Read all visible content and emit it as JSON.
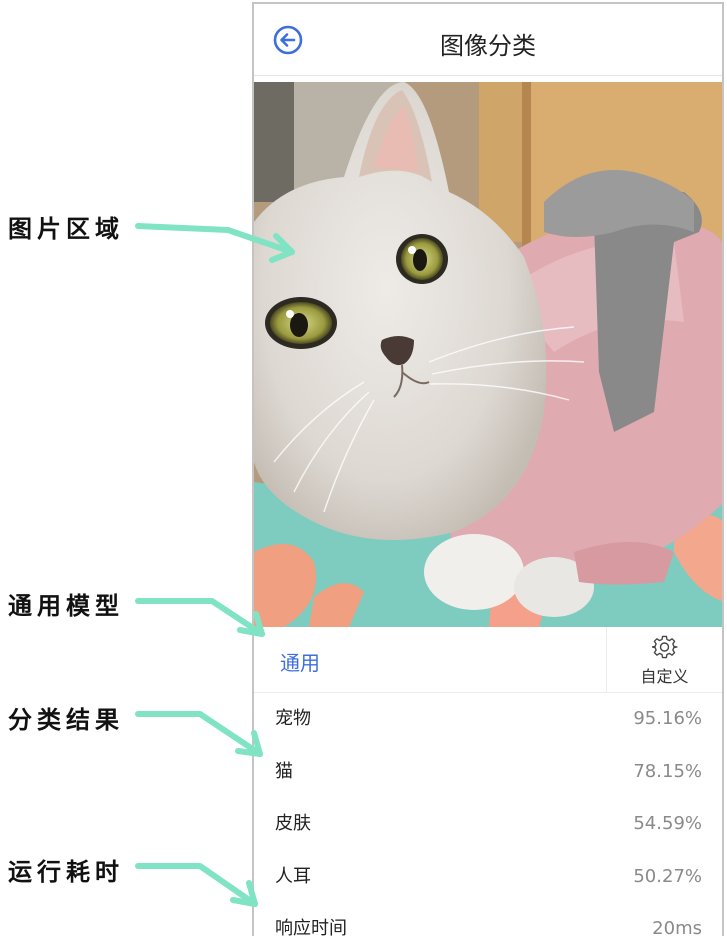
{
  "annotations": {
    "image_area": "图片区域",
    "general_model": "通用模型",
    "classification_results": "分类结果",
    "run_time": "运行耗时"
  },
  "header": {
    "title": "图像分类",
    "back_icon": "back-arrow-icon"
  },
  "model_bar": {
    "active_tab": "通用",
    "custom_label": "自定义",
    "custom_icon": "gear-icon"
  },
  "results": [
    {
      "label": "宠物",
      "score": "95.16%"
    },
    {
      "label": "猫",
      "score": "78.15%"
    },
    {
      "label": "皮肤",
      "score": "54.59%"
    },
    {
      "label": "人耳",
      "score": "50.27%"
    }
  ],
  "timing": {
    "label": "响应时间",
    "value": "20ms"
  },
  "colors": {
    "accent": "#3d6fdd",
    "arrow": "#7fe3c4",
    "muted_text": "#8a8a8a"
  }
}
